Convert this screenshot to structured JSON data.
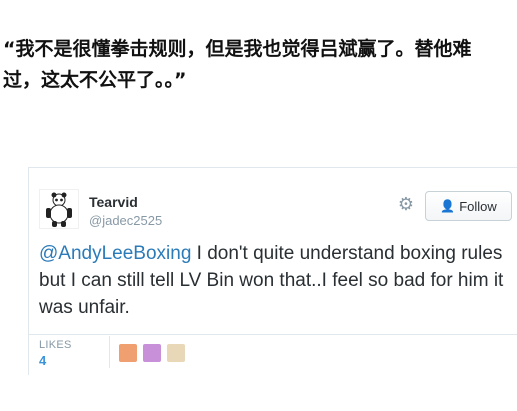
{
  "caption": {
    "line1": "“我不是很懂拳击规则，但是我也觉得吕斌赢了。替他难",
    "line2": "过，这太不公平了。。”"
  },
  "tweet": {
    "author": {
      "display_name": "Tearvid",
      "handle": "@jadec2525"
    },
    "follow_label": "Follow",
    "text": {
      "mention": "@AndyLeeBoxing",
      "body": " I don't quite understand boxing rules but I can still tell LV Bin won that..I feel so bad for him it was unfair."
    },
    "likes": {
      "label": "LIKES",
      "count": "4"
    }
  },
  "icons": {
    "settings": "gear-icon",
    "follow": "add-person-icon"
  },
  "colors": {
    "link": "#2b7bb9",
    "likes_count": "#3b94d9",
    "muted": "#8899a6",
    "text": "#292f33"
  }
}
